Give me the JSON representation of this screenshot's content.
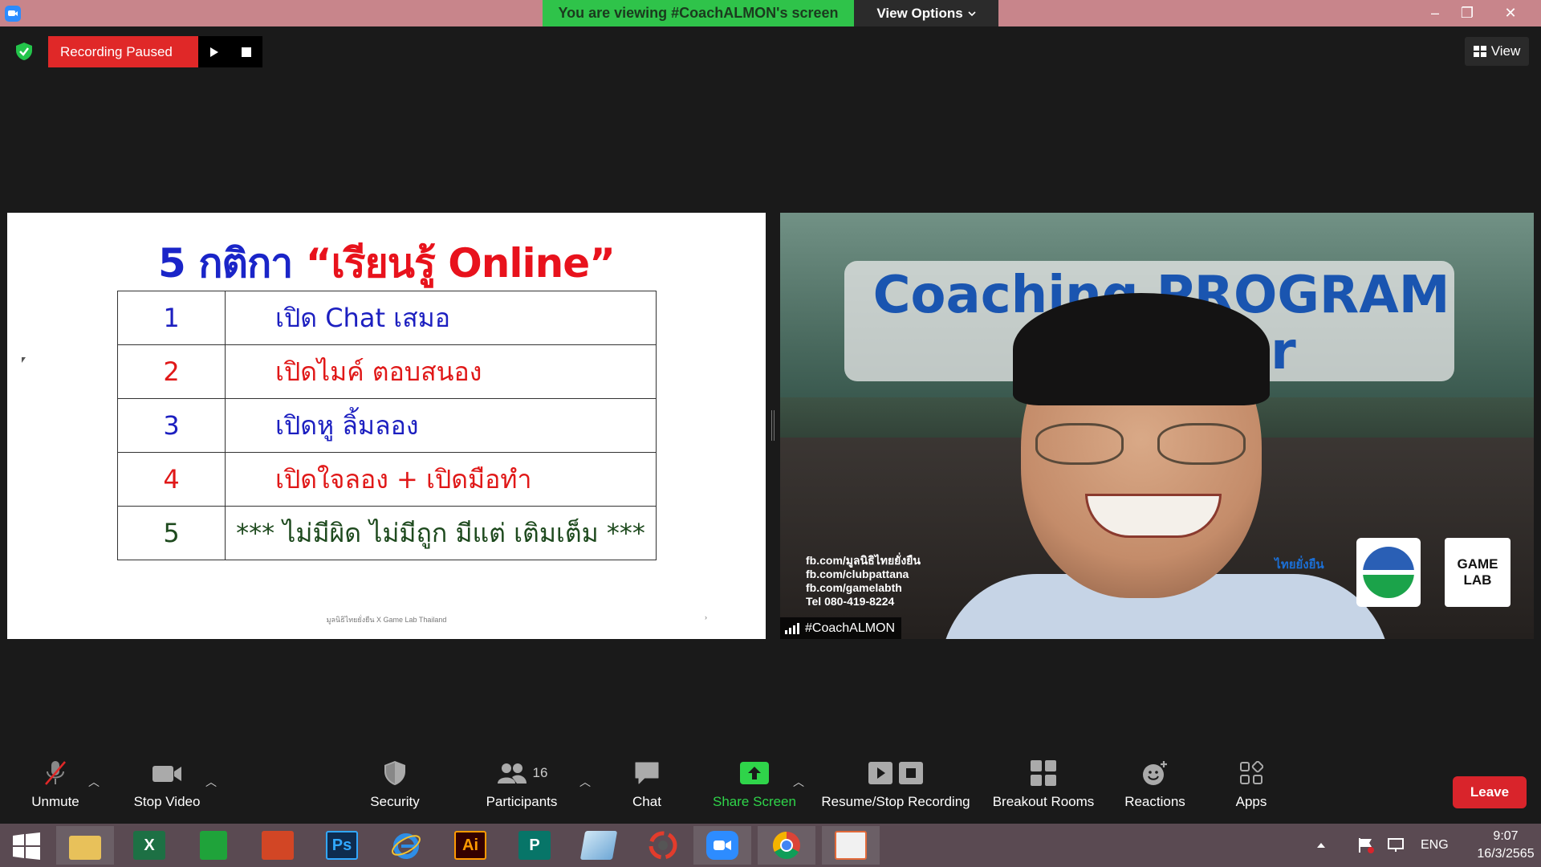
{
  "title_bar": {
    "viewing_banner": "You are viewing #CoachALMON's screen",
    "view_options_label": "View Options",
    "minimize": "–",
    "restore": "❐",
    "close": "✕"
  },
  "recording": {
    "status_label": "Recording Paused",
    "resume_icon": "play-icon",
    "stop_icon": "stop-icon"
  },
  "view_button": {
    "label": "View"
  },
  "slide": {
    "title_part1": "5 กติกา ",
    "title_part2": "“เรียนรู้ Online”",
    "rows": [
      {
        "num": "1",
        "text": "เปิด Chat เสมอ"
      },
      {
        "num": "2",
        "text": "เปิดไมค์ ตอบสนอง"
      },
      {
        "num": "3",
        "text": "เปิดหู ลิ้มลอง"
      },
      {
        "num": "4",
        "text": "เปิดใจลอง + เปิดมือทำ"
      },
      {
        "num": "5",
        "text": "*** ไม่มีผิด ไม่มีถูก มีแต่ เติมเต็ม ***"
      }
    ],
    "footer": "มูลนิธิไทยยั่งยืน X Game Lab Thailand",
    "page_marker": "›",
    "colors": {
      "title": "#1a25c8",
      "highlight": "#e8121c",
      "blue": "#1c1fc0",
      "red": "#e01818",
      "green": "#1e4a1e"
    }
  },
  "video": {
    "background_title_line1": "Coaching PROGRAM",
    "background_title_line2": "fo     urer",
    "fb_links": [
      "fb.com/มูลนิธิไทยยั่งยืน",
      "fb.com/clubpattana",
      "fb.com/gamelabth",
      "Tel 080-419-8224"
    ],
    "logo_thai": "ไทยยั่งยืน",
    "logo_gamelab_line1": "GAME",
    "logo_gamelab_line2": "LAB",
    "participant_name": "#CoachALMON"
  },
  "toolbar": {
    "unmute": "Unmute",
    "stop_video": "Stop Video",
    "security": "Security",
    "participants": "Participants",
    "participants_count": "16",
    "chat": "Chat",
    "share_screen": "Share Screen",
    "resume_stop_recording": "Resume/Stop Recording",
    "breakout_rooms": "Breakout Rooms",
    "reactions": "Reactions",
    "apps": "Apps",
    "leave": "Leave"
  },
  "taskbar": {
    "apps": [
      "file-explorer",
      "excel",
      "store",
      "powerpoint",
      "photoshop",
      "internet-explorer",
      "illustrator",
      "publisher",
      "notepad",
      "photoscape",
      "zoom",
      "chrome",
      "image-viewer"
    ],
    "app_letters": {
      "excel": "X",
      "photoshop": "Ps",
      "illustrator": "Ai",
      "publisher": "P"
    },
    "language": "ENG",
    "time": "9:07",
    "date": "16/3/2565"
  }
}
